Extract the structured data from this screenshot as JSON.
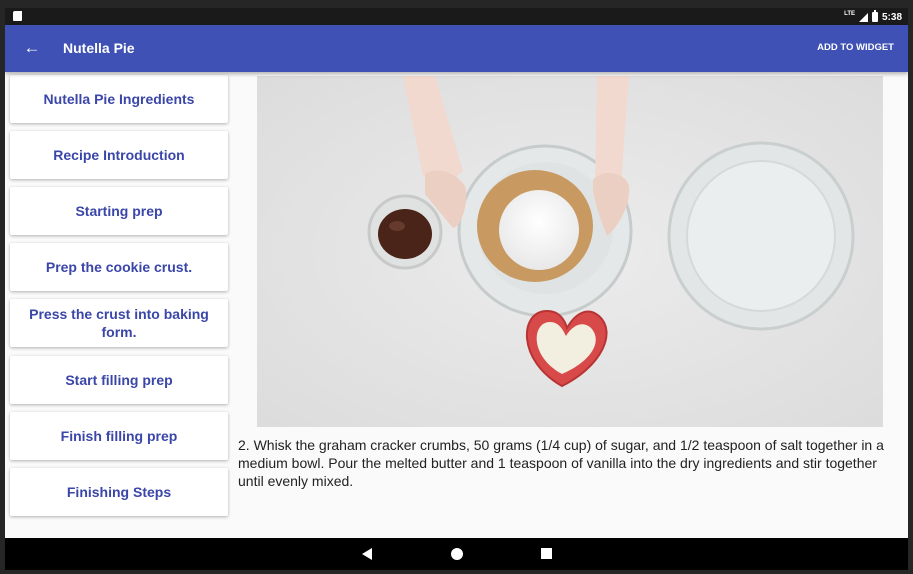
{
  "status": {
    "lte": "LTE",
    "time": "5:38"
  },
  "appbar": {
    "title": "Nutella Pie",
    "back_icon": "←",
    "action": "ADD TO WIDGET"
  },
  "steps": [
    "Nutella Pie Ingredients",
    "Recipe Introduction",
    "Starting prep",
    "Prep the cookie crust.",
    "Press the crust into baking form.",
    "Start filling prep",
    "Finish filling prep",
    "Finishing Steps"
  ],
  "video": {
    "description": "2. Whisk the graham cracker crumbs, 50 grams (1/4 cup) of sugar, and 1/2 teaspoon of salt together in a medium bowl. Pour the melted butter and 1 teaspoon of vanilla into the dry ingredients and stir together until evenly mixed."
  },
  "colors": {
    "primary": "#3f51b5",
    "step_text": "#3a46a8"
  },
  "icons": [
    "sd-card-icon",
    "signal-icon",
    "battery-icon",
    "back-arrow-icon",
    "nav-back-icon",
    "nav-home-icon",
    "nav-recent-icon"
  ]
}
